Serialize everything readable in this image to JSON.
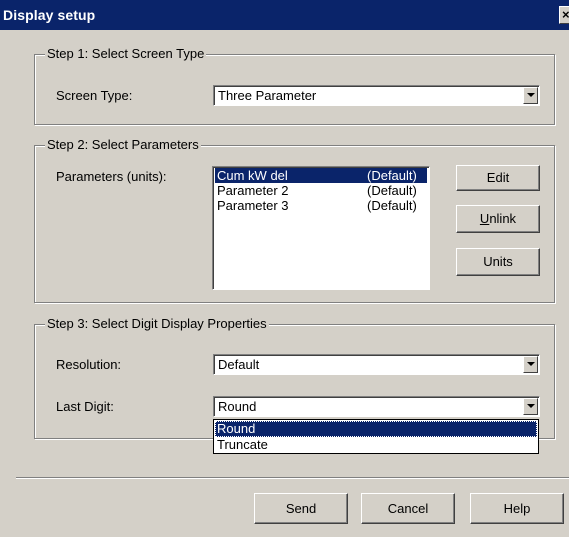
{
  "window": {
    "title": "Display setup",
    "close_glyph": "×"
  },
  "step1": {
    "legend": "Step 1: Select Screen Type",
    "screen_type_label": "Screen Type:",
    "screen_type_value": "Three Parameter"
  },
  "step2": {
    "legend": "Step 2: Select Parameters",
    "parameters_label": "Parameters (units):",
    "parameters": [
      {
        "name": "Cum kW del",
        "units": "(Default)",
        "selected": true
      },
      {
        "name": "Parameter 2",
        "units": "(Default)",
        "selected": false
      },
      {
        "name": "Parameter 3",
        "units": "(Default)",
        "selected": false
      }
    ],
    "edit_label": "Edit",
    "unlink_label": "Unlink",
    "units_label": "Units"
  },
  "step3": {
    "legend": "Step 3: Select Digit Display Properties",
    "resolution_label": "Resolution:",
    "resolution_value": "Default",
    "last_digit_label": "Last Digit:",
    "last_digit_value": "Round",
    "last_digit_options": [
      "Round",
      "Truncate"
    ],
    "last_digit_highlighted": "Round"
  },
  "footer": {
    "send_label": "Send",
    "cancel_label": "Cancel",
    "help_label": "Help"
  },
  "colors": {
    "titlebar": "#0a246a",
    "face": "#d4d0c8",
    "selection": "#0a246a"
  }
}
